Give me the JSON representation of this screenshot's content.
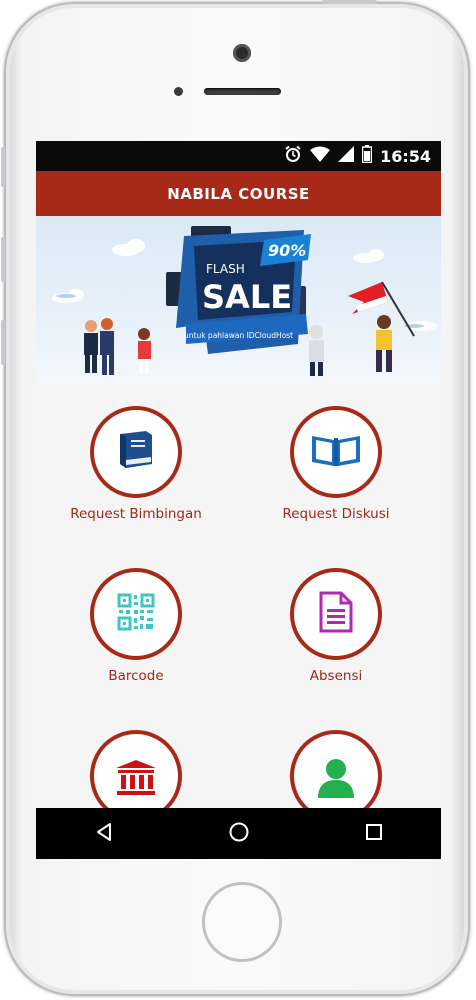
{
  "status_bar": {
    "time": "16:54",
    "icons": [
      "alarm-icon",
      "wifi-icon",
      "signal-icon",
      "battery-icon"
    ]
  },
  "app_bar": {
    "title": "NABILA COURSE"
  },
  "banner": {
    "flash_label": "FLASH",
    "sale_label": "SALE",
    "discount": "90%",
    "subtitle": "untuk pahlawan IDCloudHost"
  },
  "menu": {
    "items": [
      {
        "label": "Request Bimbingan",
        "icon": "book-icon"
      },
      {
        "label": "Request Diskusi",
        "icon": "open-book-icon"
      },
      {
        "label": "Barcode",
        "icon": "qr-code-icon"
      },
      {
        "label": "Absensi",
        "icon": "document-icon"
      },
      {
        "label": "",
        "icon": "bank-icon"
      },
      {
        "label": "",
        "icon": "user-icon"
      }
    ]
  },
  "nav_bar": {
    "buttons": [
      "back-icon",
      "home-icon",
      "recents-icon"
    ]
  },
  "colors": {
    "primary": "#a72a18",
    "background": "#f5f5f5",
    "book_icon": "#1f4e8c",
    "open_book_icon": "#1a6fc4",
    "qr_icon": "#3ec7c0",
    "document_icon": "#b02ab0",
    "bank_icon": "#cc1111",
    "user_icon": "#22b14c"
  }
}
